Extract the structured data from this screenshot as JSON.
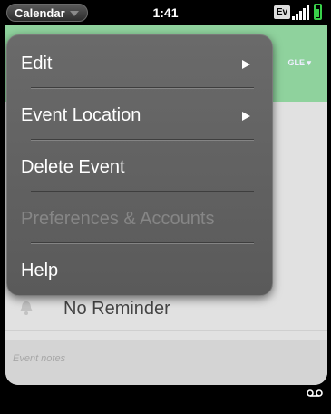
{
  "status_bar": {
    "app_name": "Calendar",
    "time": "1:41",
    "network_badge": "Ev"
  },
  "card": {
    "toggle_label": "GLE ▾",
    "reminder_label": "No Reminder",
    "notes_placeholder": "Event notes",
    "header_color": "#8fd29d"
  },
  "menu": {
    "items": [
      {
        "label": "Edit",
        "has_submenu": true,
        "enabled": true
      },
      {
        "label": "Event Location",
        "has_submenu": true,
        "enabled": true
      },
      {
        "label": "Delete Event",
        "has_submenu": false,
        "enabled": true
      },
      {
        "label": "Preferences & Accounts",
        "has_submenu": false,
        "enabled": false
      },
      {
        "label": "Help",
        "has_submenu": false,
        "enabled": true
      }
    ]
  },
  "icons": {
    "battery": "battery-icon",
    "signal": "signal-icon",
    "voicemail": "voicemail-icon",
    "reminder": "bell-icon"
  }
}
